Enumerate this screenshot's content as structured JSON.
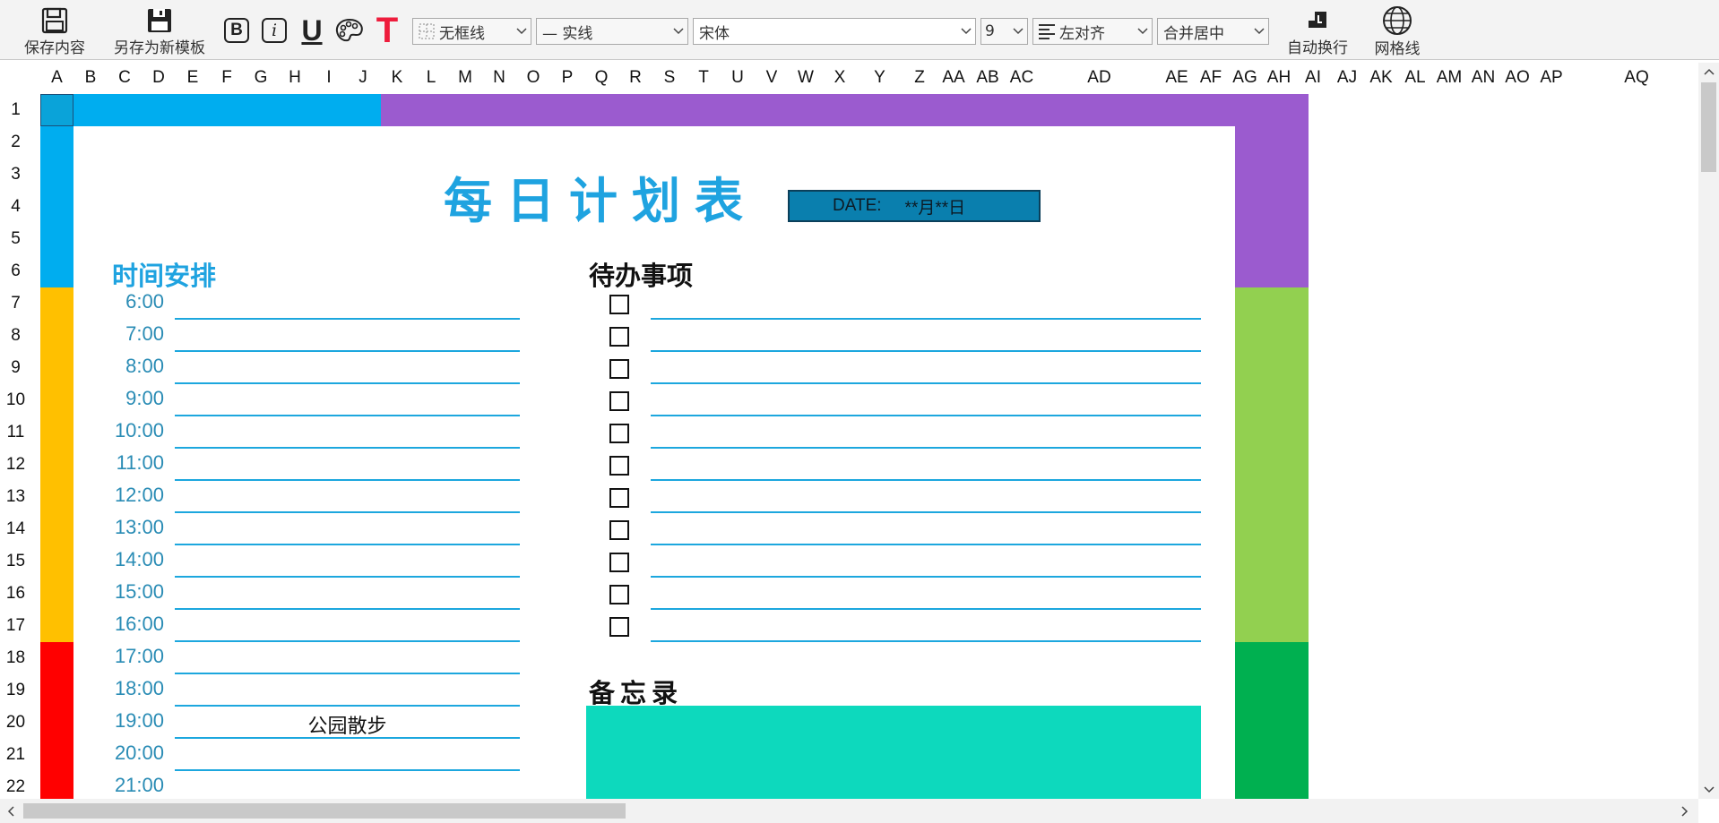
{
  "toolbar": {
    "save_label": "保存内容",
    "save_as_label": "另存为新模板",
    "bold_glyph": "B",
    "italic_glyph": "i",
    "underline_glyph": "U",
    "text_color_glyph": "T",
    "border_select": "无框线",
    "line_style_select": "— 实线",
    "font_select": "宋体",
    "font_size_select": "9",
    "align_select": "左对齐",
    "merge_select": "合并居中",
    "wrap_label": "自动换行",
    "gridlines_label": "网格线",
    "icons": [
      "save-icon",
      "save-as-icon",
      "bold-icon",
      "italic-icon",
      "underline-icon",
      "palette-icon",
      "text-color-icon",
      "border-icon",
      "align-left-icon",
      "wrap-icon",
      "globe-icon"
    ]
  },
  "columns": [
    "A",
    "B",
    "C",
    "D",
    "E",
    "F",
    "G",
    "H",
    "I",
    "J",
    "K",
    "L",
    "M",
    "N",
    "O",
    "P",
    "Q",
    "R",
    "S",
    "T",
    "U",
    "V",
    "W",
    "X",
    "Y",
    "Z",
    "AA",
    "AB",
    "AC",
    "AD",
    "AE",
    "AF",
    "AG",
    "AH",
    "AI",
    "AJ",
    "AK",
    "AL",
    "AM",
    "AN",
    "AO",
    "AP",
    "AQ"
  ],
  "rows": [
    "1",
    "2",
    "3",
    "4",
    "5",
    "6",
    "7",
    "8",
    "9",
    "10",
    "11",
    "12",
    "13",
    "14",
    "15",
    "16",
    "17",
    "18",
    "19",
    "20",
    "21",
    "22"
  ],
  "planner": {
    "title": "每日计划表",
    "date_label": "DATE:",
    "date_value": "**月**日",
    "schedule_heading": "时间安排",
    "todo_heading": "待办事项",
    "memo_heading": "备忘录",
    "times": [
      "6:00",
      "7:00",
      "8:00",
      "9:00",
      "10:00",
      "11:00",
      "12:00",
      "13:00",
      "14:00",
      "15:00",
      "16:00",
      "17:00",
      "18:00",
      "19:00",
      "20:00",
      "21:00"
    ],
    "schedule_notes": [
      "",
      "",
      "",
      "",
      "",
      "",
      "",
      "",
      "",
      "",
      "",
      "",
      "",
      "公园散步",
      "",
      ""
    ],
    "todo_count": 11,
    "colors": {
      "top_left_bar": "#00adef",
      "top_right_bar": "#9b5bcf",
      "left_bar_segments": [
        "#00adef",
        "#ffc000",
        "#ff0000"
      ],
      "right_bar_segments": [
        "#9b5bcf",
        "#92d050",
        "#00b050"
      ],
      "title": "#1fa3e0",
      "date_box": "#0a7fae",
      "memo_fill": "#0dd9bd",
      "rule_line": "#1ca7de",
      "time_text": "#2a8cb5"
    }
  }
}
